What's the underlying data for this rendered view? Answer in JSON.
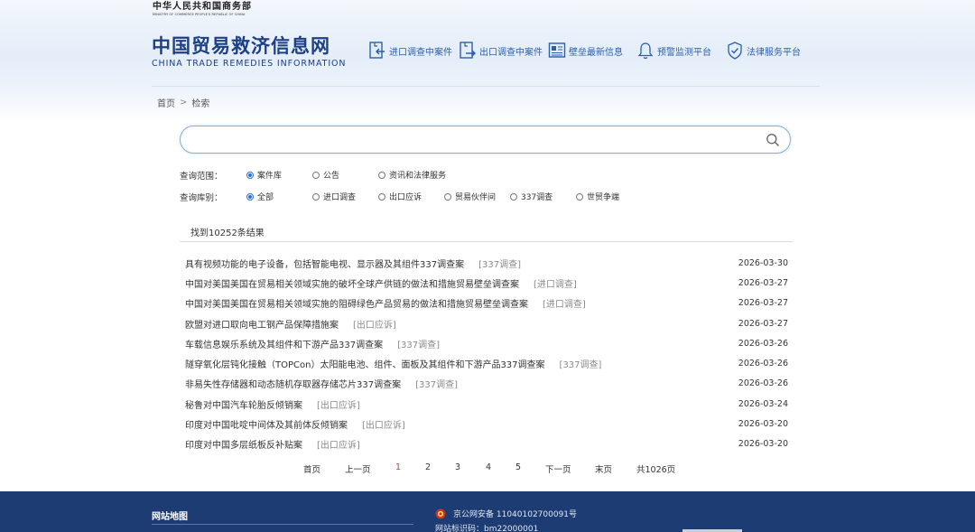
{
  "header": {
    "ministry_cn": "中华人民共和国商务部",
    "ministry_en": "MINISTRY OF COMMERCE PEOPLE'S REPUBLIC OF CHINA",
    "logo_cn": "中国贸易救济信息网",
    "logo_en": "CHINA TRADE REMEDIES INFORMATION",
    "brand_color": "#1c3f86",
    "nav": [
      {
        "label": "进口调查中案件",
        "icon": "import-case-icon"
      },
      {
        "label": "出口调查中案件",
        "icon": "export-case-icon"
      },
      {
        "label": "壁垒最新信息",
        "icon": "barrier-news-icon"
      },
      {
        "label": "预警监测平台",
        "icon": "bell-icon"
      },
      {
        "label": "法律服务平台",
        "icon": "shield-check-icon"
      }
    ]
  },
  "breadcrumb": {
    "home": "首页",
    "separator": ">",
    "current": "检索"
  },
  "search": {
    "value": "",
    "placeholder": "",
    "icon": "search-icon"
  },
  "filters": {
    "scope_label": "查询范围：",
    "scope_options": [
      {
        "label": "案件库",
        "checked": true
      },
      {
        "label": "公告",
        "checked": false
      },
      {
        "label": "资讯和法律服务",
        "checked": false
      }
    ],
    "category_label": "查询库别：",
    "category_options": [
      {
        "label": "全部",
        "checked": true
      },
      {
        "label": "进口调查",
        "checked": false
      },
      {
        "label": "出口应诉",
        "checked": false
      },
      {
        "label": "贸易伙伴间",
        "checked": false
      },
      {
        "label": "337调查",
        "checked": false
      },
      {
        "label": "世贸争端",
        "checked": false
      }
    ]
  },
  "results": {
    "count_text": "找到10252条结果",
    "items": [
      {
        "title": "具有视频功能的电子设备，包括智能电视、显示器及其组件337调查案",
        "tag": "[337调查]",
        "date": "2026-03-30"
      },
      {
        "title": "中国对美国美国在贸易相关领域实施的破坏全球产供链的做法和措施贸易壁垒调查案",
        "tag": "[进口调查]",
        "date": "2026-03-27"
      },
      {
        "title": "中国对美国美国在贸易相关领域实施的阻碍绿色产品贸易的做法和措施贸易壁垒调查案",
        "tag": "[进口调查]",
        "date": "2026-03-27"
      },
      {
        "title": "欧盟对进口取向电工钢产品保障措施案",
        "tag": "[出口应诉]",
        "date": "2026-03-27"
      },
      {
        "title": "车载信息娱乐系统及其组件和下游产品337调查案",
        "tag": "[337调查]",
        "date": "2026-03-26"
      },
      {
        "title": "隧穿氧化层钝化接触（TOPCon）太阳能电池、组件、面板及其组件和下游产品337调查案",
        "tag": "[337调查]",
        "date": "2026-03-26"
      },
      {
        "title": "非易失性存储器和动态随机存取器存储芯片337调查案",
        "tag": "[337调查]",
        "date": "2026-03-26"
      },
      {
        "title": "秘鲁对中国汽车轮胎反倾销案",
        "tag": "[出口应诉]",
        "date": "2026-03-24"
      },
      {
        "title": "印度对中国吡啶中间体及其前体反倾销案",
        "tag": "[出口应诉]",
        "date": "2026-03-20"
      },
      {
        "title": "印度对中国多层纸板反补贴案",
        "tag": "[出口应诉]",
        "date": "2026-03-20"
      }
    ]
  },
  "pagination": {
    "first": "首页",
    "prev": "上一页",
    "pages": [
      "1",
      "2",
      "3",
      "4",
      "5"
    ],
    "current": "1",
    "next": "下一页",
    "last": "末页",
    "total": "共1026页",
    "active_color": "#d03030"
  },
  "footer": {
    "map_title": "网站地图",
    "police_record": "京公网安备 11040102700091号",
    "site_id": "网站标识码：bm22000001",
    "bg_color": "#1d3c73"
  }
}
